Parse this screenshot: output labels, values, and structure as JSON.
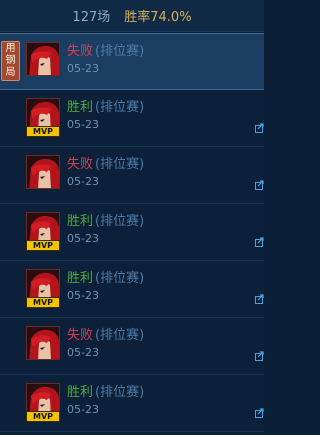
{
  "header": {
    "games": "127场",
    "winrate": "胜率74.0%"
  },
  "matches": [
    {
      "result": "失败",
      "outcome": "lose",
      "mode": "(排位赛)",
      "date": "05-23",
      "mvp": false,
      "tag": [
        "用",
        "钢",
        "局"
      ],
      "selected": true
    },
    {
      "result": "胜利",
      "outcome": "win",
      "mode": "(排位赛)",
      "date": "05-23",
      "mvp": true,
      "selected": false
    },
    {
      "result": "失败",
      "outcome": "lose",
      "mode": "(排位赛)",
      "date": "05-23",
      "mvp": false,
      "selected": false
    },
    {
      "result": "胜利",
      "outcome": "win",
      "mode": "(排位赛)",
      "date": "05-23",
      "mvp": true,
      "selected": false
    },
    {
      "result": "胜利",
      "outcome": "win",
      "mode": "(排位赛)",
      "date": "05-23",
      "mvp": true,
      "selected": false
    },
    {
      "result": "失败",
      "outcome": "lose",
      "mode": "(排位赛)",
      "date": "05-23",
      "mvp": false,
      "selected": false
    },
    {
      "result": "胜利",
      "outcome": "win",
      "mode": "(排位赛)",
      "date": "05-23",
      "mvp": true,
      "selected": false
    }
  ],
  "mvp_label": "MVP",
  "icons": {
    "avatar": "champion-portrait-icon",
    "share": "share-icon"
  },
  "colors": {
    "win": "#4fa83b",
    "lose": "#d6404a",
    "winrate": "#d8b25a"
  }
}
